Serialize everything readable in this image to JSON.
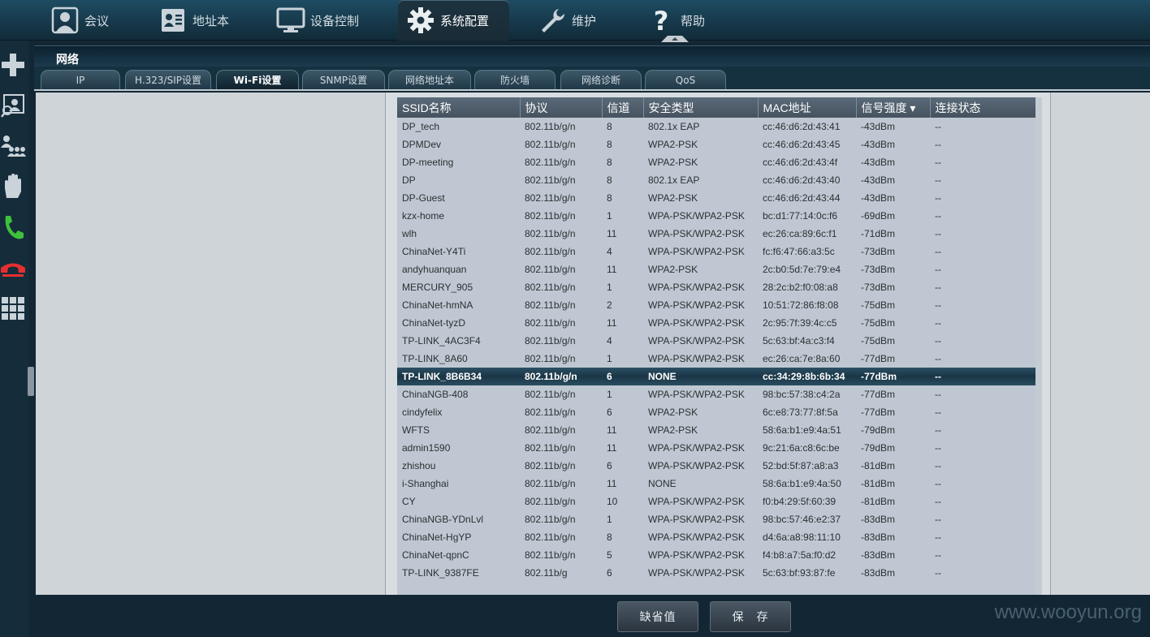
{
  "nav": {
    "items": [
      {
        "label": "会议",
        "icon": "person-icon"
      },
      {
        "label": "地址本",
        "icon": "contact-card-icon"
      },
      {
        "label": "设备控制",
        "icon": "monitor-icon"
      },
      {
        "label": "系统配置",
        "icon": "gear-icon",
        "active": true
      },
      {
        "label": "维护",
        "icon": "wrench-icon"
      },
      {
        "label": "帮助",
        "icon": "question-icon"
      }
    ]
  },
  "sidebar": {
    "tools": [
      "add-icon",
      "search-person-icon",
      "group-icon",
      "hand-icon",
      "call-icon",
      "hangup-icon",
      "keypad-icon"
    ]
  },
  "section": {
    "title": "网络"
  },
  "tabs": [
    {
      "label": "IP"
    },
    {
      "label": "H.323/SIP设置"
    },
    {
      "label": "Wi-Fi设置",
      "active": true
    },
    {
      "label": "SNMP设置"
    },
    {
      "label": "网络地址本"
    },
    {
      "label": "防火墙"
    },
    {
      "label": "网络诊断"
    },
    {
      "label": "QoS"
    }
  ],
  "table": {
    "columns": [
      "SSID名称",
      "协议",
      "信道",
      "安全类型",
      "MAC地址",
      "信号强度",
      "连接状态"
    ],
    "sort_indicator": "▾",
    "selected_row": 14,
    "rows": [
      [
        "DP_tech",
        "802.11b/g/n",
        "8",
        "802.1x EAP",
        "cc:46:d6:2d:43:41",
        "-43dBm",
        "--"
      ],
      [
        "DPMDev",
        "802.11b/g/n",
        "8",
        "WPA2-PSK",
        "cc:46:d6:2d:43:45",
        "-43dBm",
        "--"
      ],
      [
        "DP-meeting",
        "802.11b/g/n",
        "8",
        "WPA2-PSK",
        "cc:46:d6:2d:43:4f",
        "-43dBm",
        "--"
      ],
      [
        "DP",
        "802.11b/g/n",
        "8",
        "802.1x EAP",
        "cc:46:d6:2d:43:40",
        "-43dBm",
        "--"
      ],
      [
        "DP-Guest",
        "802.11b/g/n",
        "8",
        "WPA2-PSK",
        "cc:46:d6:2d:43:44",
        "-43dBm",
        "--"
      ],
      [
        "kzx-home",
        "802.11b/g/n",
        "1",
        "WPA-PSK/WPA2-PSK",
        "bc:d1:77:14:0c:f6",
        "-69dBm",
        "--"
      ],
      [
        "wlh",
        "802.11b/g/n",
        "11",
        "WPA-PSK/WPA2-PSK",
        "ec:26:ca:89:6c:f1",
        "-71dBm",
        "--"
      ],
      [
        "ChinaNet-Y4Ti",
        "802.11b/g/n",
        "4",
        "WPA-PSK/WPA2-PSK",
        "fc:f6:47:66:a3:5c",
        "-73dBm",
        "--"
      ],
      [
        "andyhuanquan",
        "802.11b/g/n",
        "11",
        "WPA2-PSK",
        "2c:b0:5d:7e:79:e4",
        "-73dBm",
        "--"
      ],
      [
        "MERCURY_905",
        "802.11b/g/n",
        "1",
        "WPA-PSK/WPA2-PSK",
        "28:2c:b2:f0:08:a8",
        "-73dBm",
        "--"
      ],
      [
        "ChinaNet-hmNA",
        "802.11b/g/n",
        "2",
        "WPA-PSK/WPA2-PSK",
        "10:51:72:86:f8:08",
        "-75dBm",
        "--"
      ],
      [
        "ChinaNet-tyzD",
        "802.11b/g/n",
        "11",
        "WPA-PSK/WPA2-PSK",
        "2c:95:7f:39:4c:c5",
        "-75dBm",
        "--"
      ],
      [
        "TP-LINK_4AC3F4",
        "802.11b/g/n",
        "4",
        "WPA-PSK/WPA2-PSK",
        "5c:63:bf:4a:c3:f4",
        "-75dBm",
        "--"
      ],
      [
        "TP-LINK_8A60",
        "802.11b/g/n",
        "1",
        "WPA-PSK/WPA2-PSK",
        "ec:26:ca:7e:8a:60",
        "-77dBm",
        "--"
      ],
      [
        "TP-LINK_8B6B34",
        "802.11b/g/n",
        "6",
        "NONE",
        "cc:34:29:8b:6b:34",
        "-77dBm",
        "--"
      ],
      [
        "ChinaNGB-408",
        "802.11b/g/n",
        "1",
        "WPA-PSK/WPA2-PSK",
        "98:bc:57:38:c4:2a",
        "-77dBm",
        "--"
      ],
      [
        "cindyfelix",
        "802.11b/g/n",
        "6",
        "WPA2-PSK",
        "6c:e8:73:77:8f:5a",
        "-77dBm",
        "--"
      ],
      [
        "WFTS",
        "802.11b/g/n",
        "11",
        "WPA2-PSK",
        "58:6a:b1:e9:4a:51",
        "-79dBm",
        "--"
      ],
      [
        "admin1590",
        "802.11b/g/n",
        "11",
        "WPA-PSK/WPA2-PSK",
        "9c:21:6a:c8:6c:be",
        "-79dBm",
        "--"
      ],
      [
        "zhishou",
        "802.11b/g/n",
        "6",
        "WPA-PSK/WPA2-PSK",
        "52:bd:5f:87:a8:a3",
        "-81dBm",
        "--"
      ],
      [
        "i-Shanghai",
        "802.11b/g/n",
        "11",
        "NONE",
        "58:6a:b1:e9:4a:50",
        "-81dBm",
        "--"
      ],
      [
        "CY",
        "802.11b/g/n",
        "10",
        "WPA-PSK/WPA2-PSK",
        "f0:b4:29:5f:60:39",
        "-81dBm",
        "--"
      ],
      [
        "ChinaNGB-YDnLvl",
        "802.11b/g/n",
        "1",
        "WPA-PSK/WPA2-PSK",
        "98:bc:57:46:e2:37",
        "-83dBm",
        "--"
      ],
      [
        "ChinaNet-HgYP",
        "802.11b/g/n",
        "8",
        "WPA-PSK/WPA2-PSK",
        "d4:6a:a8:98:11:10",
        "-83dBm",
        "--"
      ],
      [
        "ChinaNet-qpnC",
        "802.11b/g/n",
        "5",
        "WPA-PSK/WPA2-PSK",
        "f4:b8:a7:5a:f0:d2",
        "-83dBm",
        "--"
      ],
      [
        "TP-LINK_9387FE",
        "802.11b/g",
        "6",
        "WPA-PSK/WPA2-PSK",
        "5c:63:bf:93:87:fe",
        "-83dBm",
        "--"
      ]
    ]
  },
  "buttons": {
    "default_label": "缺省值",
    "save_label": "保　存"
  },
  "watermark": "www.wooyun.org",
  "colors": {
    "accent": "#1d4a61",
    "selected_row": "#1a3646"
  }
}
